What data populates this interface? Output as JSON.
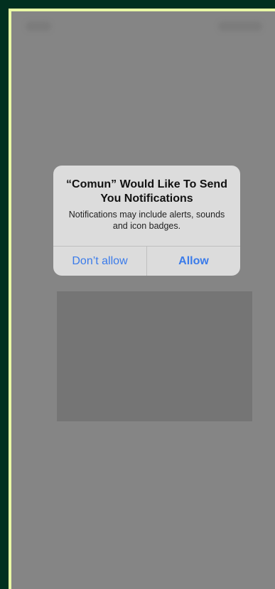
{
  "dialog": {
    "title": "“Comun” Would Like To Send You Notifications",
    "message": "Notifications may include alerts, sounds and icon badges.",
    "buttons": {
      "dont_allow": "Don’t allow",
      "allow": "Allow"
    }
  },
  "colors": {
    "outer_background": "#02301f",
    "frame_border": "#e9f8a5",
    "screen_background": "#858585",
    "placeholder_card": "#757575",
    "alert_background": "#dcdcdc",
    "button_text": "#3a7bea"
  }
}
